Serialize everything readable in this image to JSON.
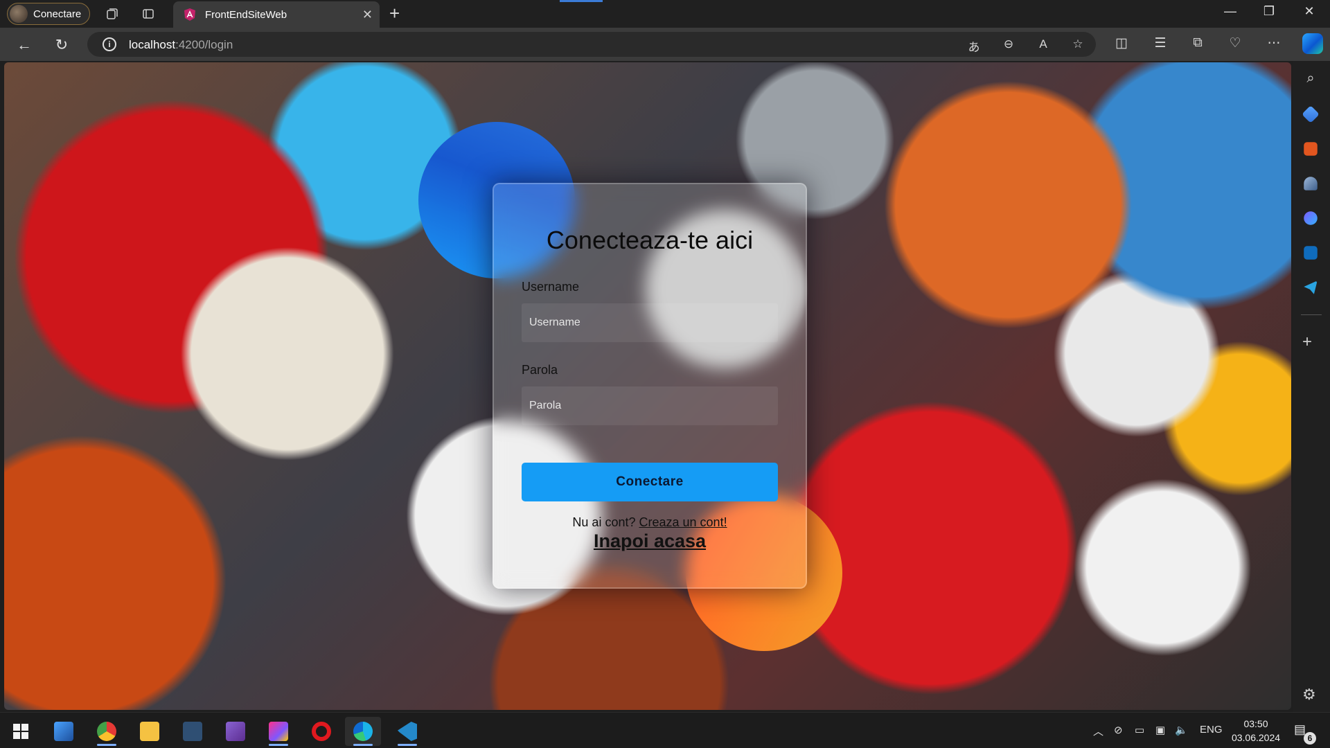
{
  "browser": {
    "profile_label": "Conectare",
    "tab_title": "FrontEndSiteWeb",
    "new_tab_symbol": "+",
    "url_host": "localhost",
    "url_path": ":4200/login",
    "accent": "#3b7bd6"
  },
  "page": {
    "title": "Conecteaza-te aici",
    "username_label": "Username",
    "username_placeholder": "Username",
    "password_label": "Parola",
    "password_placeholder": "Parola",
    "login_button": "Conectare",
    "signup_prompt": "Nu ai cont?",
    "signup_link": "Creaza un cont!",
    "home_link": "Inapoi acasa",
    "button_color": "#1a9bf0"
  },
  "taskbar": {
    "language": "ENG",
    "time": "03:50",
    "date": "03.06.2024",
    "notification_count": "6"
  },
  "icons": {
    "sidebar": [
      "search-icon",
      "tag-icon",
      "toolbox-icon",
      "chess-icon",
      "designer-icon",
      "outlook-icon",
      "telegram-icon"
    ],
    "taskbar": [
      "windows-start-icon",
      "file-explorer-icon",
      "chrome-icon",
      "folder-icon",
      "network-app-icon",
      "visual-studio-icon",
      "jetbrains-icon",
      "opera-icon",
      "edge-icon",
      "vscode-icon"
    ]
  }
}
